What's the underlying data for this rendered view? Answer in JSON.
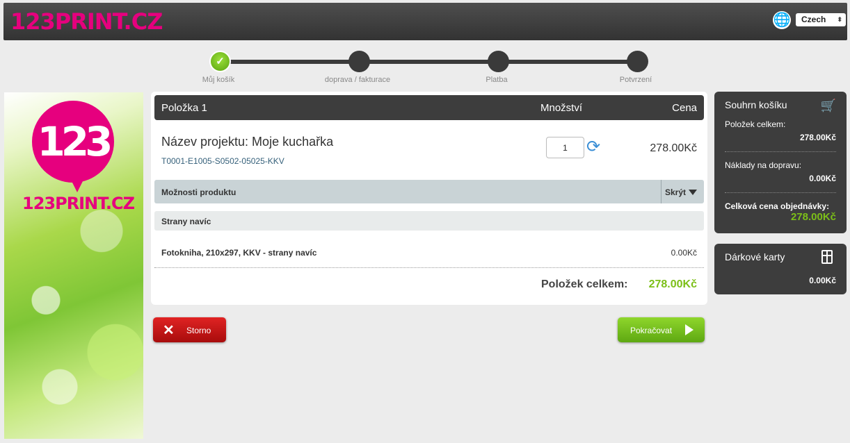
{
  "header": {
    "logo": "123PRINT.CZ",
    "language": "Czech"
  },
  "progress": {
    "steps": [
      {
        "label": "Můj košík",
        "done": true
      },
      {
        "label": "doprava / fakturace",
        "done": false
      },
      {
        "label": "Platba",
        "done": false
      },
      {
        "label": "Potvrzení",
        "done": false
      }
    ]
  },
  "banner": {
    "number": "123",
    "text": "123PRINT.CZ"
  },
  "cart": {
    "col_item": "Položka 1",
    "col_qty": "Množství",
    "col_price": "Cena",
    "project_title": "Název projektu: Moje kuchařka",
    "project_code": "T0001-E1005-S0502-05025-KKV",
    "quantity": "1",
    "price": "278.00Kč",
    "options_label": "Možnosti produktu",
    "options_toggle": "Skrýt",
    "extra_header": "Strany navíc",
    "line_name": "Fotokniha, 210x297, KKV - strany navíc",
    "line_price": "0.00Kč",
    "total_label": "Položek celkem:",
    "total_value": "278.00Kč"
  },
  "buttons": {
    "cancel": "Storno",
    "continue": "Pokračovat"
  },
  "summary": {
    "title": "Souhrn košíku",
    "items_label": "Položek celkem:",
    "items_value": "278.00Kč",
    "shipping_label": "Náklady na dopravu:",
    "shipping_value": "0.00Kč",
    "total_label": "Celková cena objednávky:",
    "total_value": "278.00Kč"
  },
  "gift": {
    "title": "Dárkové karty",
    "value": "0.00Kč"
  }
}
